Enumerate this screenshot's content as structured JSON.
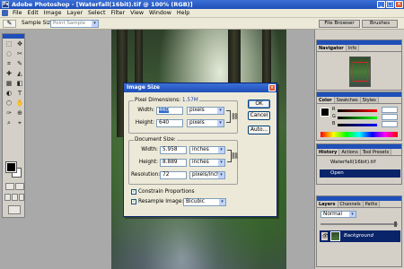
{
  "window": {
    "title": "Adobe Photoshop - [Waterfall(16bit).tif @ 100% (RGB)]",
    "app_icon_letter": "Ps",
    "minimize": "_",
    "maximize": "□",
    "close": "×"
  },
  "menu": [
    "File",
    "Edit",
    "Image",
    "Layer",
    "Select",
    "Filter",
    "View",
    "Window",
    "Help"
  ],
  "options": {
    "tool_glyph": "✎",
    "sample_size_label": "Sample Size:",
    "sample_size_value": "Point Sample",
    "file_browser_tab": "File Browser",
    "brushes_tab": "Brushes"
  },
  "toolbox": {
    "tools": [
      "⬚",
      "✥",
      "◌",
      "✂",
      "⌗",
      "✎",
      "✚",
      "◭",
      "▦",
      "◧",
      "◐",
      "T",
      "⬡",
      "✋",
      "✑",
      "⊕",
      "⌕",
      "⌖"
    ]
  },
  "dialog": {
    "title": "Image Size",
    "close": "×",
    "pixel_dimensions_label": "Pixel Dimensions:",
    "pixel_dimensions_value": "1.57M",
    "px_width_label": "Width:",
    "px_width_value": "460",
    "px_width_unit": "pixels",
    "px_height_label": "Height:",
    "px_height_value": "640",
    "px_height_unit": "pixels",
    "document_size_label": "Document Size:",
    "doc_width_label": "Width:",
    "doc_width_value": "5.958",
    "doc_width_unit": "inches",
    "doc_height_label": "Height:",
    "doc_height_value": "8.889",
    "doc_height_unit": "inches",
    "resolution_label": "Resolution:",
    "resolution_value": "72",
    "resolution_unit": "pixels/inch",
    "ok": "OK",
    "cancel": "Cancel",
    "auto": "Auto...",
    "constrain_label": "Constrain Proportions",
    "resample_label": "Resample Image:",
    "resample_value": "Bicubic",
    "check": "✓",
    "dropdown_arrow": "▾",
    "chain_glyph": "⛓"
  },
  "panels": {
    "navigator": {
      "tabs": [
        "Navigator",
        "Info"
      ]
    },
    "color": {
      "tabs": [
        "Color",
        "Swatches",
        "Styles"
      ],
      "labels": [
        "R",
        "G",
        "B"
      ]
    },
    "history": {
      "tabs": [
        "History",
        "Actions",
        "Tool Presets"
      ],
      "rows": [
        "Waterfall(16bit).tif",
        "Open"
      ]
    },
    "layers": {
      "tabs": [
        "Layers",
        "Channels",
        "Paths"
      ],
      "blend_mode": "Normal",
      "layer_name": "Background",
      "eye_glyph": "👁"
    }
  }
}
